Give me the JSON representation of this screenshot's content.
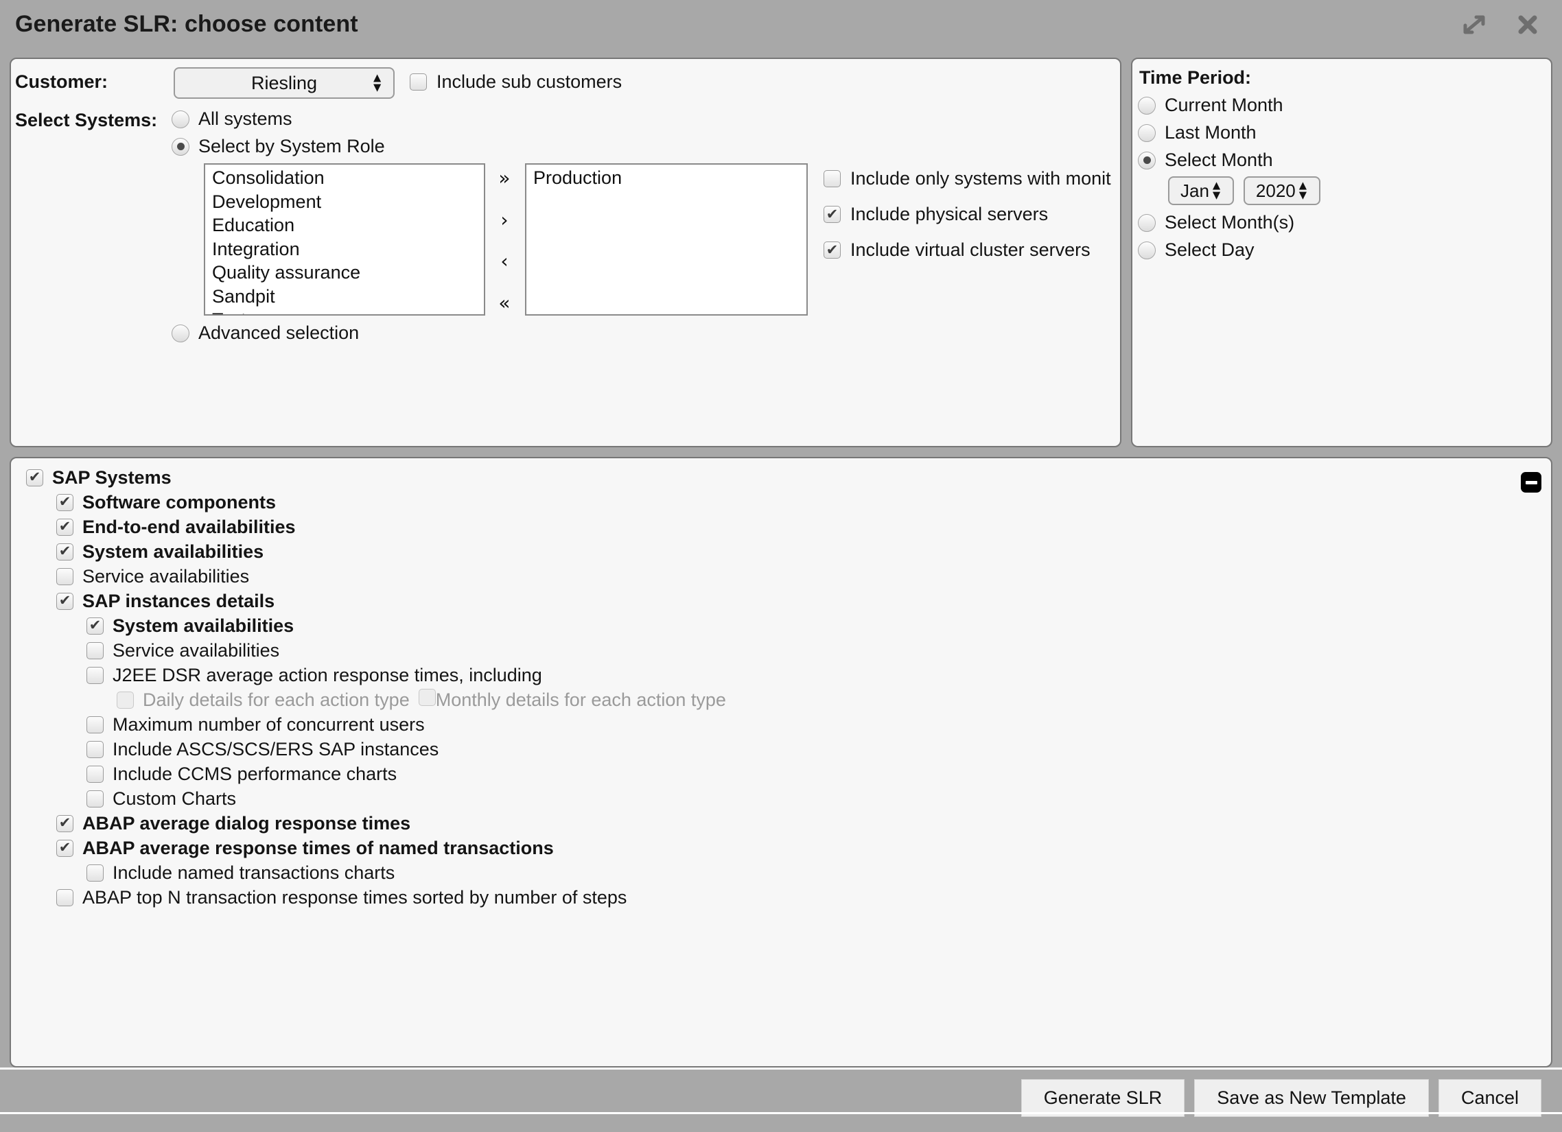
{
  "window": {
    "title": "Generate SLR: choose content",
    "expand_icon": "expand-diagonal-icon",
    "close_icon": "close-icon"
  },
  "customer": {
    "label": "Customer:",
    "selected": "Riesling",
    "include_sub_label": "Include sub customers",
    "include_sub_checked": false
  },
  "select_systems": {
    "label": "Select Systems:",
    "options": [
      {
        "label": "All systems",
        "selected": false
      },
      {
        "label": "Select by System Role",
        "selected": true
      },
      {
        "label": "Advanced selection",
        "selected": false
      }
    ],
    "available_roles": [
      "Consolidation",
      "Development",
      "Education",
      "Integration",
      "Quality assurance",
      "Sandpit",
      "Test"
    ],
    "selected_roles": [
      "Production"
    ],
    "transfer_buttons": [
      "»",
      "›",
      "‹",
      "«"
    ],
    "system_checks": [
      {
        "label": "Include only systems with monit",
        "checked": false
      },
      {
        "label": "Include physical servers",
        "checked": true
      },
      {
        "label": "Include virtual cluster servers",
        "checked": true
      }
    ]
  },
  "time_period": {
    "title": "Time Period:",
    "options": [
      {
        "label": "Current Month",
        "selected": false
      },
      {
        "label": "Last Month",
        "selected": false
      },
      {
        "label": "Select Month",
        "selected": true
      },
      {
        "label": "Select Month(s)",
        "selected": false
      },
      {
        "label": "Select Day",
        "selected": false
      }
    ],
    "month": "Jan",
    "year": "2020"
  },
  "content": {
    "collapse_icon": "collapse-minus-icon",
    "rows": [
      {
        "label": "SAP Systems",
        "level": 0,
        "checked": true,
        "disabled": false
      },
      {
        "label": "Software components",
        "level": 1,
        "checked": true,
        "disabled": false
      },
      {
        "label": "End-to-end availabilities",
        "level": 1,
        "checked": true,
        "disabled": false
      },
      {
        "label": "System availabilities",
        "level": 1,
        "checked": true,
        "disabled": false
      },
      {
        "label": "Service availabilities",
        "level": 1,
        "checked": false,
        "disabled": false
      },
      {
        "label": "SAP instances details",
        "level": 1,
        "checked": true,
        "disabled": false
      },
      {
        "label": "System availabilities",
        "level": 2,
        "checked": true,
        "disabled": false
      },
      {
        "label": "Service availabilities",
        "level": 2,
        "checked": false,
        "disabled": false
      },
      {
        "label": "J2EE DSR average action response times, including",
        "level": 2,
        "checked": false,
        "disabled": false
      },
      {
        "label": "Daily details for each action type",
        "level": 3,
        "checked": false,
        "disabled": true,
        "second_label": "Monthly details for each action type",
        "second_checked": false,
        "second_disabled": true
      },
      {
        "label": "Maximum number of concurrent users",
        "level": 2,
        "checked": false,
        "disabled": false
      },
      {
        "label": "Include ASCS/SCS/ERS SAP instances",
        "level": 2,
        "checked": false,
        "disabled": false
      },
      {
        "label": "Include CCMS performance charts",
        "level": 2,
        "checked": false,
        "disabled": false
      },
      {
        "label": "Custom Charts",
        "level": 2,
        "checked": false,
        "disabled": false
      },
      {
        "label": "ABAP average dialog response times",
        "level": 1,
        "checked": true,
        "disabled": false
      },
      {
        "label": "ABAP average response times of named transactions",
        "level": 1,
        "checked": true,
        "disabled": false
      },
      {
        "label": "Include named transactions charts",
        "level": 2,
        "checked": false,
        "disabled": false
      },
      {
        "label": "ABAP top N transaction response times sorted by number of steps",
        "level": 1,
        "checked": false,
        "disabled": false
      }
    ]
  },
  "footer": {
    "buttons": [
      "Generate SLR",
      "Save as New Template",
      "Cancel"
    ]
  }
}
